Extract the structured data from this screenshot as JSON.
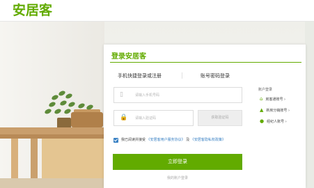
{
  "brand": {
    "logo": "安居客",
    "color": "#62ab00"
  },
  "panel": {
    "title": "登录安居客",
    "tabs": [
      {
        "label": "手机快捷登录或注册",
        "active": true
      },
      {
        "label": "账号密码登录",
        "active": false
      }
    ],
    "phone_placeholder": "请输入手机号码",
    "code_placeholder": "请输入验证码",
    "get_code_label": "获取验证码",
    "agreement": {
      "prefix": "我已阅读并接受",
      "link1": "《安居客用户服务协议》",
      "and": "及",
      "link2": "《安居客隐私权政策》",
      "checked": true
    },
    "login_button": "立即登录",
    "footer_link": "我的账户登录",
    "side": {
      "heading": "账户登录",
      "links": [
        {
          "label": "房客通账号",
          "icon": "house-icon"
        },
        {
          "label": "新房分销账号",
          "icon": "building-icon"
        },
        {
          "label": "经纪人账号",
          "icon": "person-icon"
        }
      ]
    }
  },
  "colors": {
    "accent": "#62ab00",
    "link": "#3b82c4"
  }
}
